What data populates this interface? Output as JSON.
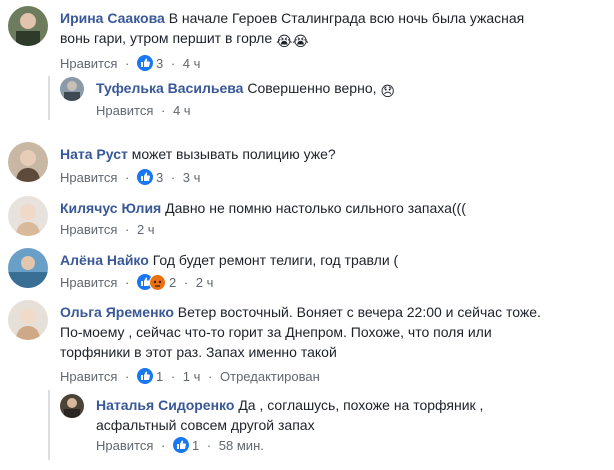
{
  "comments": [
    {
      "author": "Ирина Саакова",
      "text1": "В начале Героев Сталинграда всю ночь была ужасная",
      "text2": "вонь гари, утром першит в горле",
      "emoji": "😭😭",
      "like": "Нравится",
      "reaction_count": "3",
      "time": "4 ч"
    },
    {
      "author": "Туфелька Васильева",
      "text1": "Совершенно верно,",
      "emoji": "😞",
      "like": "Нравится",
      "time": "4 ч"
    },
    {
      "author": "Ната Руст",
      "text1": "может вызывать полицию уже?",
      "like": "Нравится",
      "reaction_count": "3",
      "time": "3 ч"
    },
    {
      "author": "Килячус Юлия",
      "text1": "Давно не помню настолько сильного запаха(((",
      "like": "Нравится",
      "time": "2 ч"
    },
    {
      "author": "Алёна Найко",
      "text1": "Год будет ремонт телиги, год травли (",
      "like": "Нравится",
      "reaction_count": "2",
      "time": "2 ч"
    },
    {
      "author": "Ольга Яременко",
      "text1": "Ветер восточный. Воняет с вечера 22:00 и сейчас тоже.",
      "text2": "По-моему , сейчас что-то горит за Днепром. Похоже, что поля или",
      "text3": "торфяники в этот раз. Запах именно такой",
      "like": "Нравится",
      "reaction_count": "1",
      "time": "1 ч",
      "edited": "Отредактирован"
    },
    {
      "author": "Наталья Сидоренко",
      "text1": "Да , соглашусь, похоже на торфяник ,",
      "text2": "асфальтный совсем другой запах",
      "like": "Нравится",
      "reaction_count": "1",
      "time": "58 мин."
    }
  ],
  "separator": "·",
  "colors": {
    "author": "#385898",
    "text": "#1d2129",
    "meta": "#616770",
    "like_blue": "#1877f2",
    "angry": "#e9710f"
  },
  "icons": {
    "like": "like-reaction-icon",
    "angry": "angry-reaction-icon"
  }
}
